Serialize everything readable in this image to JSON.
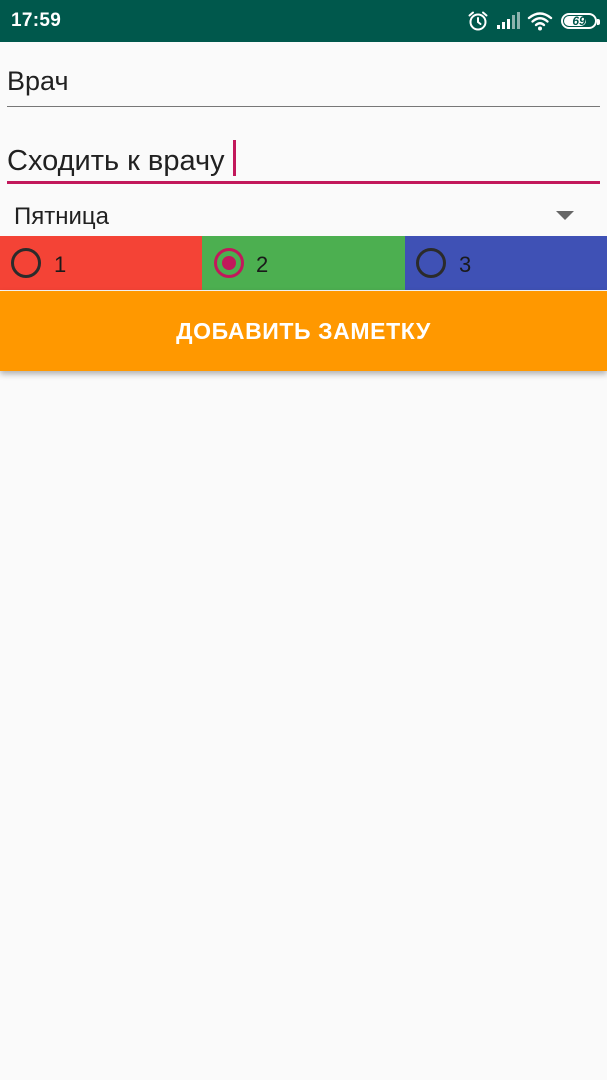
{
  "status_bar": {
    "time": "17:59",
    "battery_percent": "69",
    "background_color": "#00584c",
    "icons": [
      "alarm-icon",
      "signal-icon",
      "wifi-icon",
      "battery-icon"
    ]
  },
  "form": {
    "title_field": {
      "value": "Врач"
    },
    "note_field": {
      "value": "Сходить к врачу",
      "focused": true,
      "accent_color": "#c2185b"
    },
    "day_spinner": {
      "selected": "Пятница"
    },
    "priority": {
      "options": [
        {
          "label": "1",
          "color": "#f44336",
          "checked": false
        },
        {
          "label": "2",
          "color": "#4caf50",
          "checked": true
        },
        {
          "label": "3",
          "color": "#3f51b5",
          "checked": false
        }
      ]
    },
    "add_button": {
      "label": "ДОБАВИТЬ ЗАМЕТКУ",
      "color": "#ff9800"
    }
  }
}
